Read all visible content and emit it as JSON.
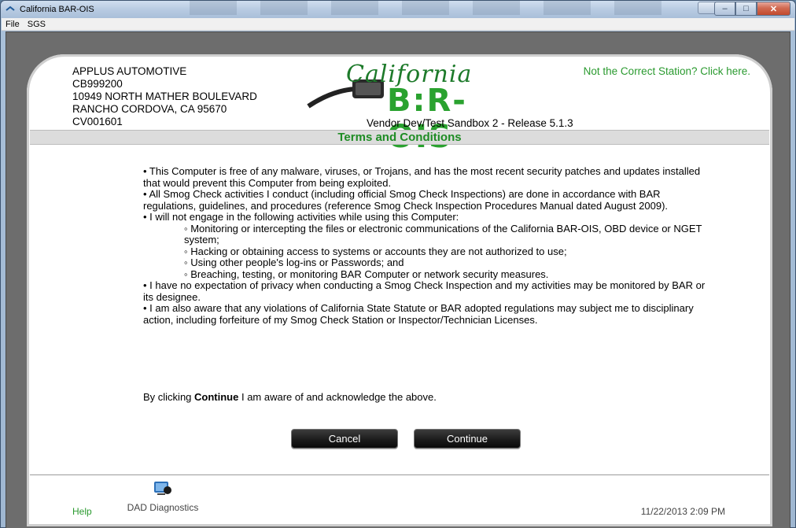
{
  "window": {
    "title": "California BAR-OIS",
    "controls": {
      "minimize": "–",
      "maximize": "□",
      "close": "✕"
    }
  },
  "menu": {
    "items": [
      "File",
      "SGS"
    ]
  },
  "station": {
    "name": "APPLUS AUTOMOTIVE",
    "id": "CB999200",
    "address1": "10949 NORTH MATHER BOULEVARD",
    "address2": "RANCHO CORDOVA, CA 95670",
    "code": "CV001601"
  },
  "header": {
    "logo_script": "California",
    "logo_main": "B:R-OIS",
    "release": "Vendor Dev/Test Sandbox 2 - Release 5.1.3",
    "wrong_station_link": "Not the Correct Station? Click here."
  },
  "terms": {
    "title": "Terms and Conditions",
    "lines": [
      "•  This Computer is free of any malware, viruses, or Trojans, and has the most recent security patches and updates installed that would prevent this Computer from being exploited.",
      "•  All Smog Check activities I conduct (including official Smog Check Inspections) are done in accordance with BAR regulations, guidelines, and procedures (reference Smog Check Inspection Procedures Manual dated August 2009).",
      "•  I will not engage in the following activities while using this Computer:"
    ],
    "sublines": [
      "◦  Monitoring or intercepting the files or electronic communications of the California BAR-OIS, OBD device or NGET system;",
      "◦  Hacking or obtaining access to systems or accounts they are not authorized to use;",
      "◦  Using other people's log-ins or Passwords; and",
      "◦  Breaching, testing, or monitoring BAR Computer or network security measures."
    ],
    "lines2": [
      "•  I have no expectation of privacy when conducting a Smog Check Inspection and my activities may be monitored by BAR or its designee.",
      "•  I am also aware that any violations of California State Statute or BAR adopted regulations may subject me to disciplinary action, including forfeiture of my Smog Check Station or Inspector/Technician Licenses."
    ],
    "ack_prefix": "By clicking ",
    "ack_bold": "Continue",
    "ack_suffix": " I am aware of and acknowledge the above."
  },
  "buttons": {
    "cancel": "Cancel",
    "continue": "Continue"
  },
  "footer": {
    "help": "Help",
    "diagnostics": "DAD Diagnostics",
    "datetime": "11/22/2013 2:09 PM"
  },
  "colors": {
    "brand_green": "#2aa22f",
    "title_green": "#1e8c24"
  }
}
